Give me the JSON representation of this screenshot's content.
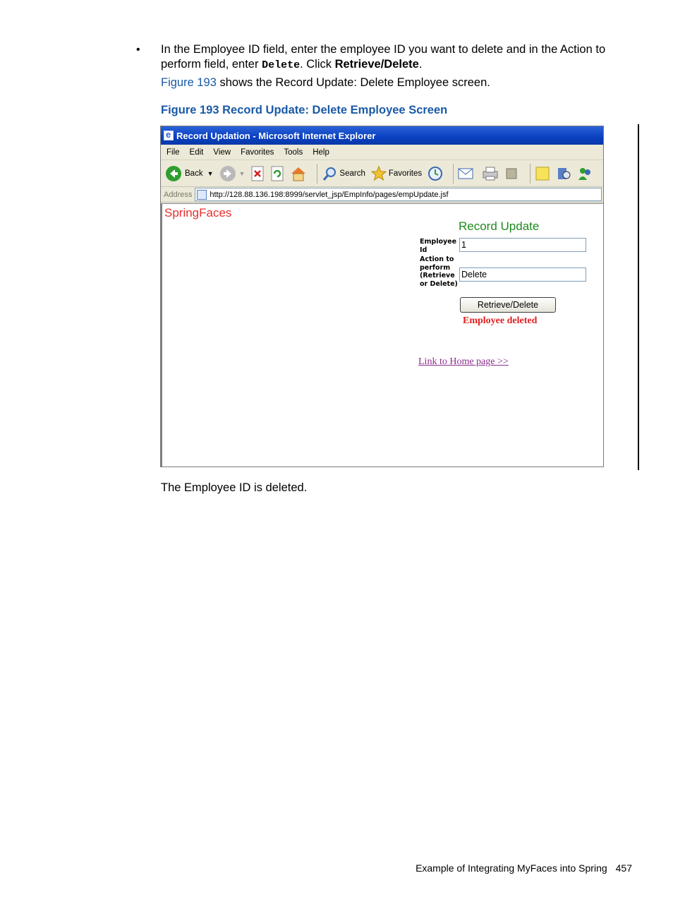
{
  "instruction": {
    "part1": "In the Employee ID field, enter the employee ID you want to delete and in the Action to perform field, enter ",
    "code": "Delete",
    "part2": ". Click ",
    "bold": "Retrieve/Delete",
    "part3": "."
  },
  "figure_ref": {
    "link_text": "Figure 193",
    "rest": " shows the Record Update: Delete Employee screen."
  },
  "caption": "Figure 193 Record Update: Delete Employee Screen",
  "browser": {
    "title": "Record Updation - Microsoft Internet Explorer",
    "menu": [
      "File",
      "Edit",
      "View",
      "Favorites",
      "Tools",
      "Help"
    ],
    "toolbar": {
      "back": "Back",
      "search": "Search",
      "favorites": "Favorites"
    },
    "address_label": "Address",
    "url": "http://128.88.136.198:8999/servlet_jsp/EmpInfo/pages/empUpdate.jsf"
  },
  "app": {
    "brand": "SpringFaces",
    "form_title": "Record Update",
    "employee_id_label": "Employee Id",
    "employee_id_value": "1",
    "action_label": "Action to perform (Retrieve or Delete)",
    "action_value": "Delete",
    "button": "Retrieve/Delete",
    "status": "Employee deleted",
    "home_link": "Link to Home page >>"
  },
  "result_text": "The Employee ID is deleted.",
  "footer": {
    "section": "Example of Integrating MyFaces into Spring",
    "page": "457"
  }
}
